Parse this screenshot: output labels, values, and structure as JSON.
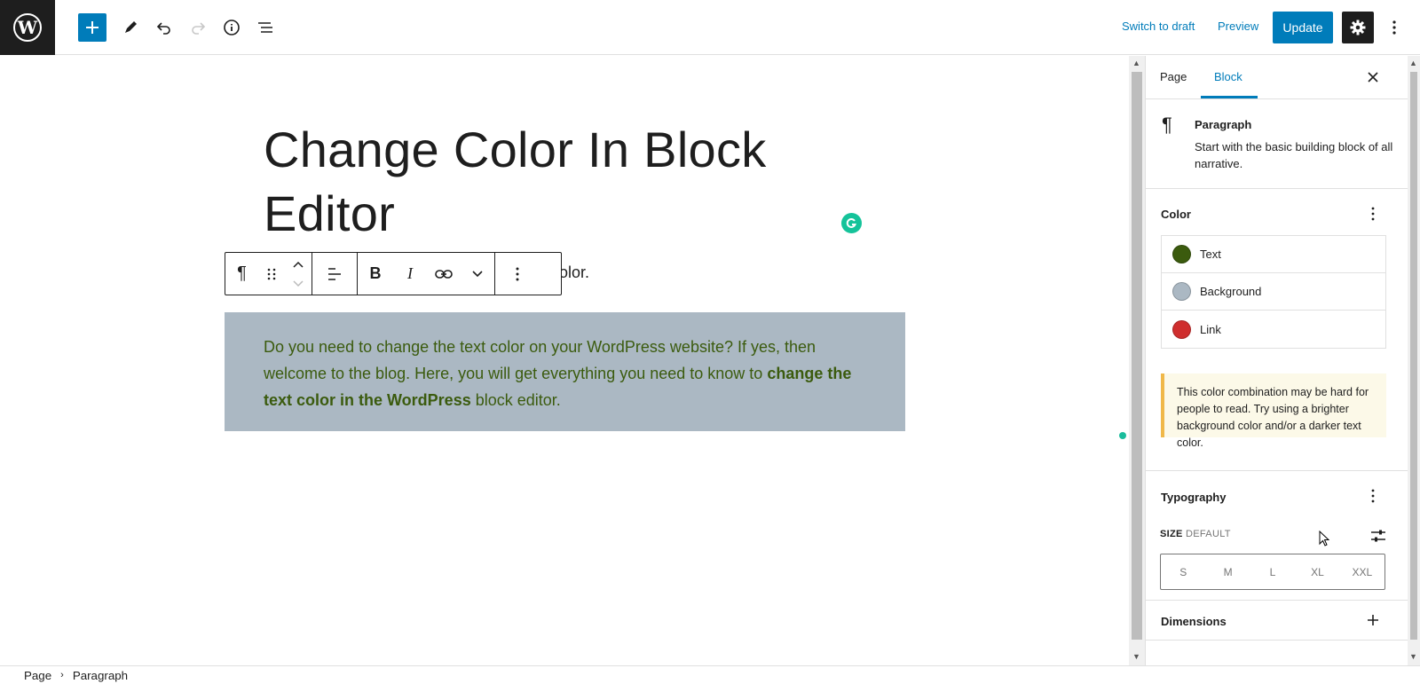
{
  "colors": {
    "accent": "#007cba",
    "dark": "#1e1e1e",
    "text_swatch": "#3b5b0e",
    "background_swatch": "#abb8c3",
    "link_swatch": "#cf2e2e",
    "grammarly": "#15c39a",
    "notice_border": "#f0b849"
  },
  "topbar": {
    "logo_icon": "wordpress-logo-icon",
    "tools": [
      "add-block-icon",
      "edit-tool-icon",
      "undo-icon",
      "redo-icon",
      "details-info-icon",
      "list-view-icon"
    ],
    "switch_to_draft": "Switch to draft",
    "preview": "Preview",
    "update": "Update",
    "settings_icon": "gear-icon",
    "options_icon": "more-vertical-icon"
  },
  "editor": {
    "title": "Change Color In Block Editor",
    "partial_paragraph": "olor.",
    "block_toolbar": [
      "paragraph-icon",
      "drag-handle-icon",
      "move-up-icon",
      "move-down-icon",
      "align-icon",
      "bold-icon",
      "italic-icon",
      "link-icon",
      "more-rich-text-icon",
      "block-options-icon"
    ],
    "selected_paragraph": {
      "text_before": "Do you need to change the text color on your WordPress website? If yes, then welcome to the blog. Here, you will get everything you need to know to ",
      "bold_text": "change the text color in the WordPress",
      "text_after": " block editor."
    }
  },
  "sidebar": {
    "tabs": [
      {
        "label": "Page"
      },
      {
        "label": "Block"
      }
    ],
    "active_tab": "Block",
    "close_icon": "close-icon",
    "block_card": {
      "icon": "paragraph-icon",
      "title": "Paragraph",
      "description": "Start with the basic building block of all narrative."
    },
    "color_panel": {
      "title": "Color",
      "items": [
        {
          "label": "Text"
        },
        {
          "label": "Background"
        },
        {
          "label": "Link"
        }
      ],
      "notice": "This color combination may be hard for people to read. Try using a brighter background color and/or a darker text color."
    },
    "typography_panel": {
      "title": "Typography",
      "size_label": "SIZE",
      "size_value": "DEFAULT",
      "sizes": [
        "S",
        "M",
        "L",
        "XL",
        "XXL"
      ]
    },
    "dimensions_panel": {
      "title": "Dimensions"
    }
  },
  "footer": {
    "breadcrumbs": [
      "Page",
      "Paragraph"
    ]
  }
}
